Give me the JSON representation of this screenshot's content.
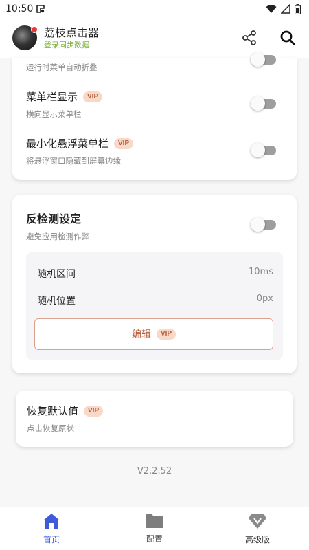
{
  "status_bar": {
    "time": "10:50"
  },
  "header": {
    "app_name": "荔枝点击器",
    "subtitle": "登录同步数据",
    "share_icon": "share-icon",
    "search_icon": "search-icon"
  },
  "menu_settings": {
    "items": [
      {
        "title": "",
        "desc": "运行时菜单自动折叠",
        "vip": false,
        "enabled": false
      },
      {
        "title": "菜单栏显示",
        "desc": "横向显示菜单栏",
        "vip": true,
        "enabled": false
      },
      {
        "title": "最小化悬浮菜单栏",
        "desc": "将悬浮窗口隐藏到屏幕边缘",
        "vip": true,
        "enabled": false
      }
    ]
  },
  "anti_detect": {
    "title": "反检测设定",
    "desc": "避免应用检测作弊",
    "enabled": false,
    "random_interval_label": "随机区间",
    "random_interval_value": "10ms",
    "random_position_label": "随机位置",
    "random_position_value": "0px",
    "edit_label": "编辑"
  },
  "restore": {
    "title": "恢复默认值",
    "desc": "点击恢复原状"
  },
  "vip_label": "VIP",
  "version": "V2.2.52",
  "bottom_nav": {
    "items": [
      {
        "label": "首页",
        "icon": "home-icon",
        "active": true
      },
      {
        "label": "配置",
        "icon": "folder-icon",
        "active": false
      },
      {
        "label": "高级版",
        "icon": "diamond-icon",
        "active": false
      }
    ]
  },
  "colors": {
    "accent": "#3f5bd8",
    "vip_bg": "#f8d8c8",
    "vip_text": "#b85a36",
    "sync_text": "#7cae3a"
  }
}
